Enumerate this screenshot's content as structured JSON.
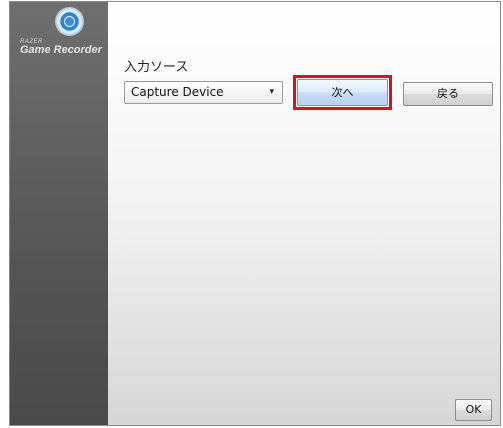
{
  "logo": {
    "brand_text": "RAZER",
    "product_text": "Game Recorder"
  },
  "input_source": {
    "label": "入力ソース",
    "selected_value": "Capture Device",
    "caret": "▾"
  },
  "buttons": {
    "next_label": "次へ",
    "back_label": "戻る",
    "ok_label": "OK"
  },
  "colors": {
    "highlight": "#e01010",
    "sidebar": "#5a5a5a"
  }
}
